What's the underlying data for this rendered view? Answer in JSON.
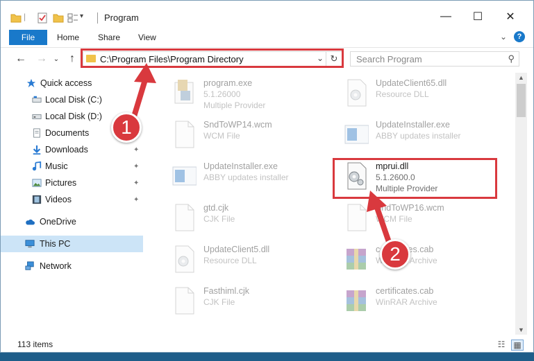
{
  "window": {
    "title": "Program",
    "controls": {
      "minimize": "—",
      "maximize": "☐",
      "close": "✕"
    }
  },
  "ribbon": {
    "tabs": [
      "File",
      "Home",
      "Share",
      "View"
    ],
    "expand_glyph": "⌄",
    "help_glyph": "?"
  },
  "address": {
    "path": "C:\\Program Files\\Program Directory",
    "dropdown_glyph": "⌄",
    "refresh_glyph": "↻",
    "back_glyph": "←",
    "forward_glyph": "→",
    "recent_glyph": "⌄",
    "up_glyph": "↑"
  },
  "search": {
    "placeholder": "Search Program",
    "icon_glyph": "⚲"
  },
  "nav": {
    "items": [
      {
        "label": "Quick access",
        "icon": "star-icon"
      },
      {
        "label": "Local Disk (C:)",
        "icon": "drive-icon"
      },
      {
        "label": "Local Disk (D:)",
        "icon": "drive-icon"
      },
      {
        "label": "Documents",
        "icon": "documents-icon"
      },
      {
        "label": "Downloads",
        "icon": "download-icon"
      },
      {
        "label": "Music",
        "icon": "music-icon"
      },
      {
        "label": "Pictures",
        "icon": "pictures-icon"
      },
      {
        "label": "Videos",
        "icon": "videos-icon"
      },
      {
        "label": "OneDrive",
        "icon": "cloud-icon"
      },
      {
        "label": "This PC",
        "icon": "computer-icon"
      },
      {
        "label": "Network",
        "icon": "network-icon"
      }
    ],
    "pin_glyph": "📌"
  },
  "files": [
    {
      "name": "program.exe",
      "sub1": "5.1.26000",
      "sub2": "Multiple Provider",
      "icon": "exe-icon"
    },
    {
      "name": "UpdateClient65.dll",
      "sub1": "Resource DLL",
      "icon": "dll-icon"
    },
    {
      "name": "SndToWP14.wcm",
      "sub1": "WCM File",
      "icon": "generic-file-icon"
    },
    {
      "name": "UpdateInstaller.exe",
      "sub1": "ABBY updates installer",
      "icon": "installer-icon"
    },
    {
      "name": "UpdateInstaller.exe",
      "sub1": "ABBY updates installer",
      "icon": "installer-icon"
    },
    {
      "name": "mprui.dll",
      "sub1": "5.1.2600.0",
      "sub2": "Multiple Provider",
      "icon": "dll-icon"
    },
    {
      "name": "gtd.cjk",
      "sub1": "CJK File",
      "icon": "generic-file-icon"
    },
    {
      "name": "SndToWP16.wcm",
      "sub1": "WCM File",
      "icon": "generic-file-icon"
    },
    {
      "name": "UpdateClient5.dll",
      "sub1": "Resource DLL",
      "icon": "dll-icon"
    },
    {
      "name": "certificates.cab",
      "sub1": "WinRAR Archive",
      "icon": "archive-icon"
    },
    {
      "name": "Fasthiml.cjk",
      "sub1": "CJK File",
      "icon": "generic-file-icon"
    },
    {
      "name": "certificates.cab",
      "sub1": "WinRAR Archive",
      "icon": "archive-icon"
    }
  ],
  "status": {
    "count": "113 items"
  },
  "callouts": {
    "one": "1",
    "two": "2"
  },
  "colors": {
    "accent": "#1979ca",
    "highlight": "#d9393e",
    "selection": "#cce4f7"
  }
}
